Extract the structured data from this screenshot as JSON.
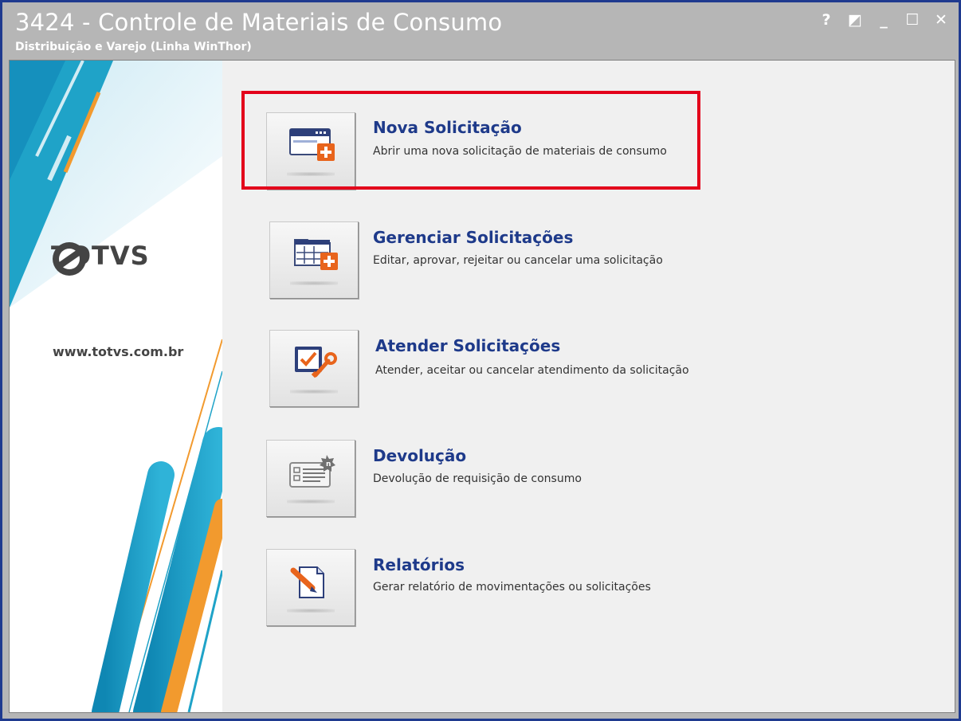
{
  "window": {
    "title": "3424 - Controle de Materiais de Consumo",
    "subtitle": "Distribuição e Varejo (Linha WinThor)",
    "controls": {
      "help": "?",
      "restore": "◩",
      "minimize": "_",
      "maximize": "☐",
      "close": "✕"
    }
  },
  "banner": {
    "logo_text": "TOTVS",
    "website": "www.totvs.com.br"
  },
  "menu": {
    "items": [
      {
        "id": "nova",
        "label": "Nova Solicitação",
        "description": "Abrir uma nova solicitação de materiais de consumo",
        "icon": "new-window-icon"
      },
      {
        "id": "gerenciar",
        "label": "Gerenciar Solicitações",
        "description": "Editar, aprovar, rejeitar ou cancelar uma solicitação",
        "icon": "grid-add-icon"
      },
      {
        "id": "atender",
        "label": "Atender Solicitações",
        "description": "Atender, aceitar ou cancelar atendimento da solicitação",
        "icon": "checklist-tools-icon"
      },
      {
        "id": "devolucao",
        "label": "Devolução",
        "description": "Devolução de requisição de consumo",
        "icon": "form-badge-icon"
      },
      {
        "id": "relatorios",
        "label": "Relatórios",
        "description": "Gerar relatório de movimentações ou solicitações",
        "icon": "report-pen-icon"
      }
    ]
  },
  "colors": {
    "label": "#1e3a8a",
    "highlight": "#e3001b",
    "accent_blue": "#1fa3c8",
    "accent_orange": "#f29a2e"
  }
}
